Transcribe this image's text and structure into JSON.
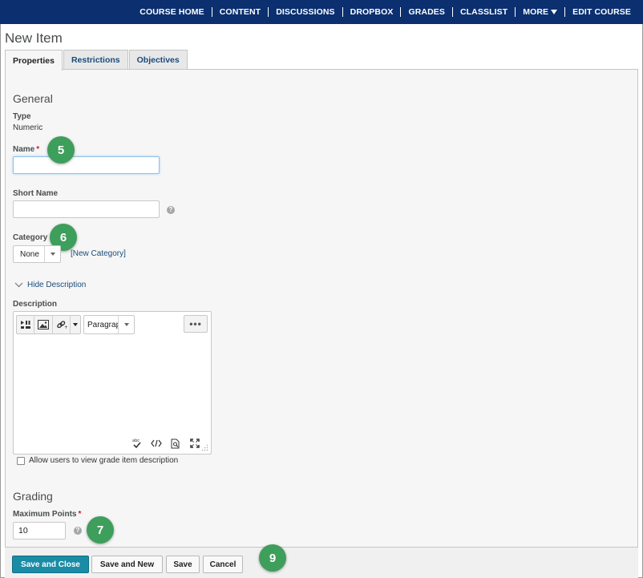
{
  "nav": {
    "items": [
      "COURSE HOME",
      "CONTENT",
      "DISCUSSIONS",
      "DROPBOX",
      "GRADES",
      "CLASSLIST",
      "MORE",
      "EDIT COURSE"
    ]
  },
  "page": {
    "title": "New Item"
  },
  "tabs": [
    "Properties",
    "Restrictions",
    "Objectives"
  ],
  "general": {
    "heading": "General",
    "type_label": "Type",
    "type_value": "Numeric",
    "name_label": "Name",
    "required_mark": "*",
    "name_value": "",
    "short_name_label": "Short Name",
    "short_name_value": "",
    "category_label": "Category",
    "category_value": "None",
    "new_category_link": "[New Category]",
    "hide_description_link": "Hide Description",
    "description_label": "Description",
    "format_select_value": "Paragraph",
    "more_actions_label": "•••",
    "allow_view_description_label": "Allow users to view grade item description"
  },
  "grading": {
    "heading": "Grading",
    "max_points_label": "Maximum Points",
    "max_points_value": "10"
  },
  "callouts": [
    "5",
    "6",
    "7",
    "9"
  ],
  "buttons": {
    "save_close": "Save and Close",
    "save_new": "Save and New",
    "save": "Save",
    "cancel": "Cancel"
  },
  "colors": {
    "nav_bg": "#0b2f6f",
    "primary_button": "#1a8ca6",
    "callout": "#3e9e5b",
    "required": "#cd2026",
    "link": "#1a4b7a"
  }
}
